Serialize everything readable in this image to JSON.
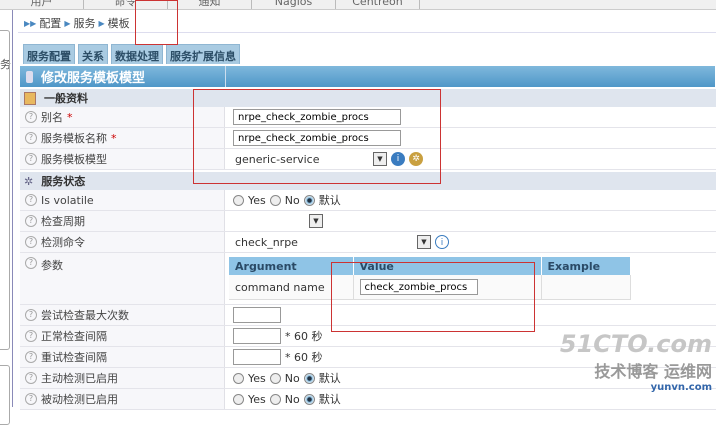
{
  "topnav": [
    "用户",
    "命令",
    "通知",
    "Nagios",
    "Centreon"
  ],
  "sidebar_glyph": "务",
  "breadcrumb": [
    "配置",
    "服务",
    "模板"
  ],
  "tabs": [
    "服务配置",
    "关系",
    "数据处理",
    "服务扩展信息"
  ],
  "form_title": "修改服务模板模型",
  "section_general": "一般资料",
  "alias": {
    "label": "别名",
    "required": "*",
    "value": "nrpe_check_zombie_procs"
  },
  "template_name": {
    "label": "服务模板名称",
    "required": "*",
    "value": "nrpe_check_zombie_procs"
  },
  "template_model": {
    "label": "服务模板模型",
    "value": "generic-service"
  },
  "section_status": "服务状态",
  "is_volatile": {
    "label": "Is volatile",
    "options": [
      "Yes",
      "No",
      "默认"
    ],
    "selected": "默认"
  },
  "check_period": {
    "label": "检查周期",
    "value": ""
  },
  "check_command": {
    "label": "检测命令",
    "value": "check_nrpe"
  },
  "args": {
    "label": "参数",
    "headers": [
      "Argument",
      "Value",
      "Example"
    ],
    "rows": [
      {
        "argument": "command name",
        "value": "check_zombie_procs",
        "example": ""
      }
    ]
  },
  "max_attempts": {
    "label": "尝试检查最大次数",
    "value": ""
  },
  "normal_interval": {
    "label": "正常检查间隔",
    "value": "",
    "unit": "* 60 秒"
  },
  "retry_interval": {
    "label": "重试检查间隔",
    "value": "",
    "unit": "* 60 秒"
  },
  "active_checks": {
    "label": "主动检测已启用",
    "options": [
      "Yes",
      "No",
      "默认"
    ],
    "selected": "默认"
  },
  "passive_checks": {
    "label": "被动检测已启用",
    "options": [
      "Yes",
      "No",
      "默认"
    ],
    "selected": "默认"
  },
  "watermark": {
    "line1": "51CTO.com",
    "line2": "技术博客 运维网",
    "line3": "yunvn.com"
  }
}
